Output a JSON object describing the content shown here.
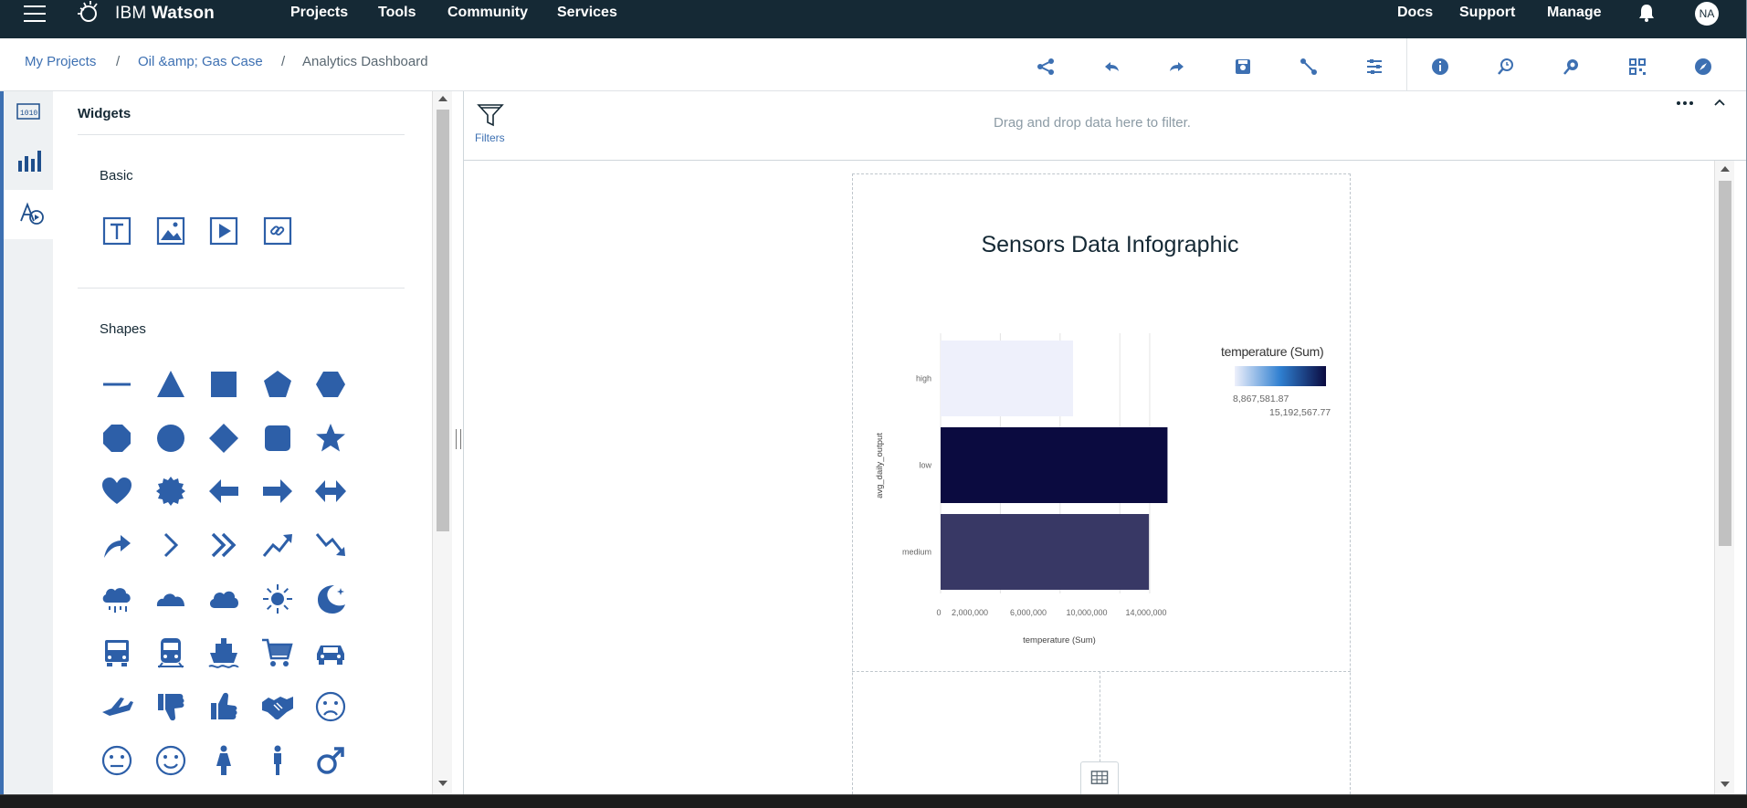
{
  "app": {
    "brand_prefix": "IBM",
    "brand_name": "Watson",
    "nav": [
      "Projects",
      "Tools",
      "Community",
      "Services"
    ],
    "nav_right": [
      "Docs",
      "Support",
      "Manage"
    ],
    "avatar_initials": "NA"
  },
  "breadcrumb": {
    "items": [
      "My Projects",
      "Oil &amp; Gas Case",
      "Analytics Dashboard"
    ],
    "separator": "/"
  },
  "toolbar": {
    "icons": [
      "share-icon",
      "undo-icon",
      "redo-icon",
      "save-icon",
      "connection-icon",
      "properties-icon",
      "info-icon",
      "zoom-icon",
      "search-icon",
      "grid-icon",
      "compass-icon"
    ]
  },
  "rail": {
    "items": [
      "data-sources-icon",
      "visualizations-icon",
      "widgets-icon"
    ],
    "active": "widgets-icon"
  },
  "widgets_panel": {
    "title": "Widgets",
    "basic_label": "Basic",
    "basic_icons": [
      "text-widget-icon",
      "image-widget-icon",
      "video-widget-icon",
      "web-page-widget-icon"
    ],
    "shapes_label": "Shapes",
    "shape_icons": [
      "line-icon",
      "triangle-icon",
      "square-icon",
      "pentagon-icon",
      "hexagon-icon",
      "octagon-icon",
      "circle-icon",
      "diamond-icon",
      "rounded-square-icon",
      "star-icon",
      "heart-icon",
      "seal-icon",
      "arrow-left-icon",
      "arrow-right-icon",
      "double-arrow-icon",
      "curved-arrow-icon",
      "chevron-right-icon",
      "double-chevron-icon",
      "trend-up-icon",
      "trend-down-icon",
      "rain-icon",
      "cloud-flat-icon",
      "cloud-icon",
      "sun-icon",
      "moon-icon",
      "truck-icon",
      "train-icon",
      "ship-icon",
      "shopping-cart-icon",
      "car-icon",
      "airplane-icon",
      "thumbs-down-icon",
      "thumbs-up-icon",
      "handshake-icon",
      "sad-face-icon",
      "neutral-face-icon",
      "happy-face-icon",
      "woman-icon",
      "man-icon",
      "male-symbol-icon"
    ]
  },
  "filters": {
    "label": "Filters",
    "hint": "Drag and drop data here to filter."
  },
  "infographic": {
    "title": "Sensors Data Infographic"
  },
  "colors": {
    "nav_bg": "#152935",
    "accent": "#3d70b2",
    "icon_blue": "#2d5fa8"
  },
  "chart_data": {
    "type": "bar",
    "orientation": "horizontal",
    "categories": [
      "high",
      "low",
      "medium"
    ],
    "values": [
      8867581.87,
      15192567.77,
      13950000
    ],
    "xlabel": "temperature (Sum)",
    "ylabel": "avg_daily_output",
    "xticks": [
      "0",
      "2,000,000",
      "6,000,000",
      "10,000,000",
      "14,000,000"
    ],
    "xlim": [
      0,
      15900000
    ],
    "legend": {
      "title": "temperature (Sum)",
      "min_label": "8,867,581.87",
      "max_label": "15,192,567.77",
      "min_value": 8867581.87,
      "max_value": 15192567.77,
      "color_low": "#eef0fb",
      "color_high": "#0b0b40",
      "placement": "right"
    },
    "grid": true
  }
}
